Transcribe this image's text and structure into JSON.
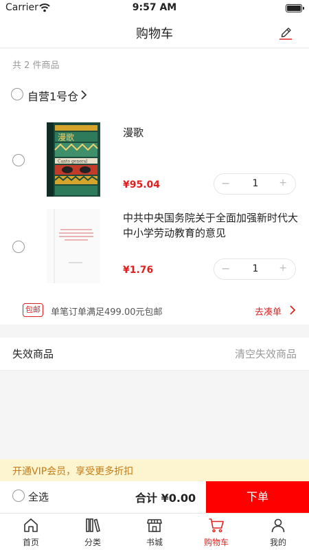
{
  "status_bar": {
    "carrier": "Carrier",
    "time": "9:57 AM"
  },
  "header": {
    "title": "购物车"
  },
  "cart": {
    "count_text": "共 2 件商品",
    "store": {
      "name": "自营1号仓"
    },
    "items": [
      {
        "title": "漫歌",
        "price": "¥95.04",
        "quantity": "1",
        "cover_title": "漫歌",
        "cover_subtitle": "Canto general"
      },
      {
        "title": "中共中央国务院关于全面加强新时代大中小学劳动教育的意见",
        "price": "¥1.76",
        "quantity": "1"
      }
    ],
    "shipping": {
      "badge": "包邮",
      "text": "单笔订单满足499.00元包邮",
      "link": "去凑单"
    },
    "invalid": {
      "title": "失效商品",
      "clear_label": "清空失效商品"
    }
  },
  "vip_banner": {
    "text": "开通VIP会员，享受更多折扣"
  },
  "checkout": {
    "select_all_label": "全选",
    "total_text": "合计 ¥0.00",
    "order_label": "下单"
  },
  "tabs": [
    {
      "label": "首页",
      "icon": "home-icon"
    },
    {
      "label": "分类",
      "icon": "books-icon"
    },
    {
      "label": "书城",
      "icon": "store-icon"
    },
    {
      "label": "购物车",
      "icon": "cart-icon",
      "active": true
    },
    {
      "label": "我的",
      "icon": "user-icon"
    }
  ],
  "colors": {
    "accent": "#e02020",
    "order_button": "#ff0000",
    "vip_bg": "#fdf5cf",
    "vip_text": "#c47a16"
  }
}
